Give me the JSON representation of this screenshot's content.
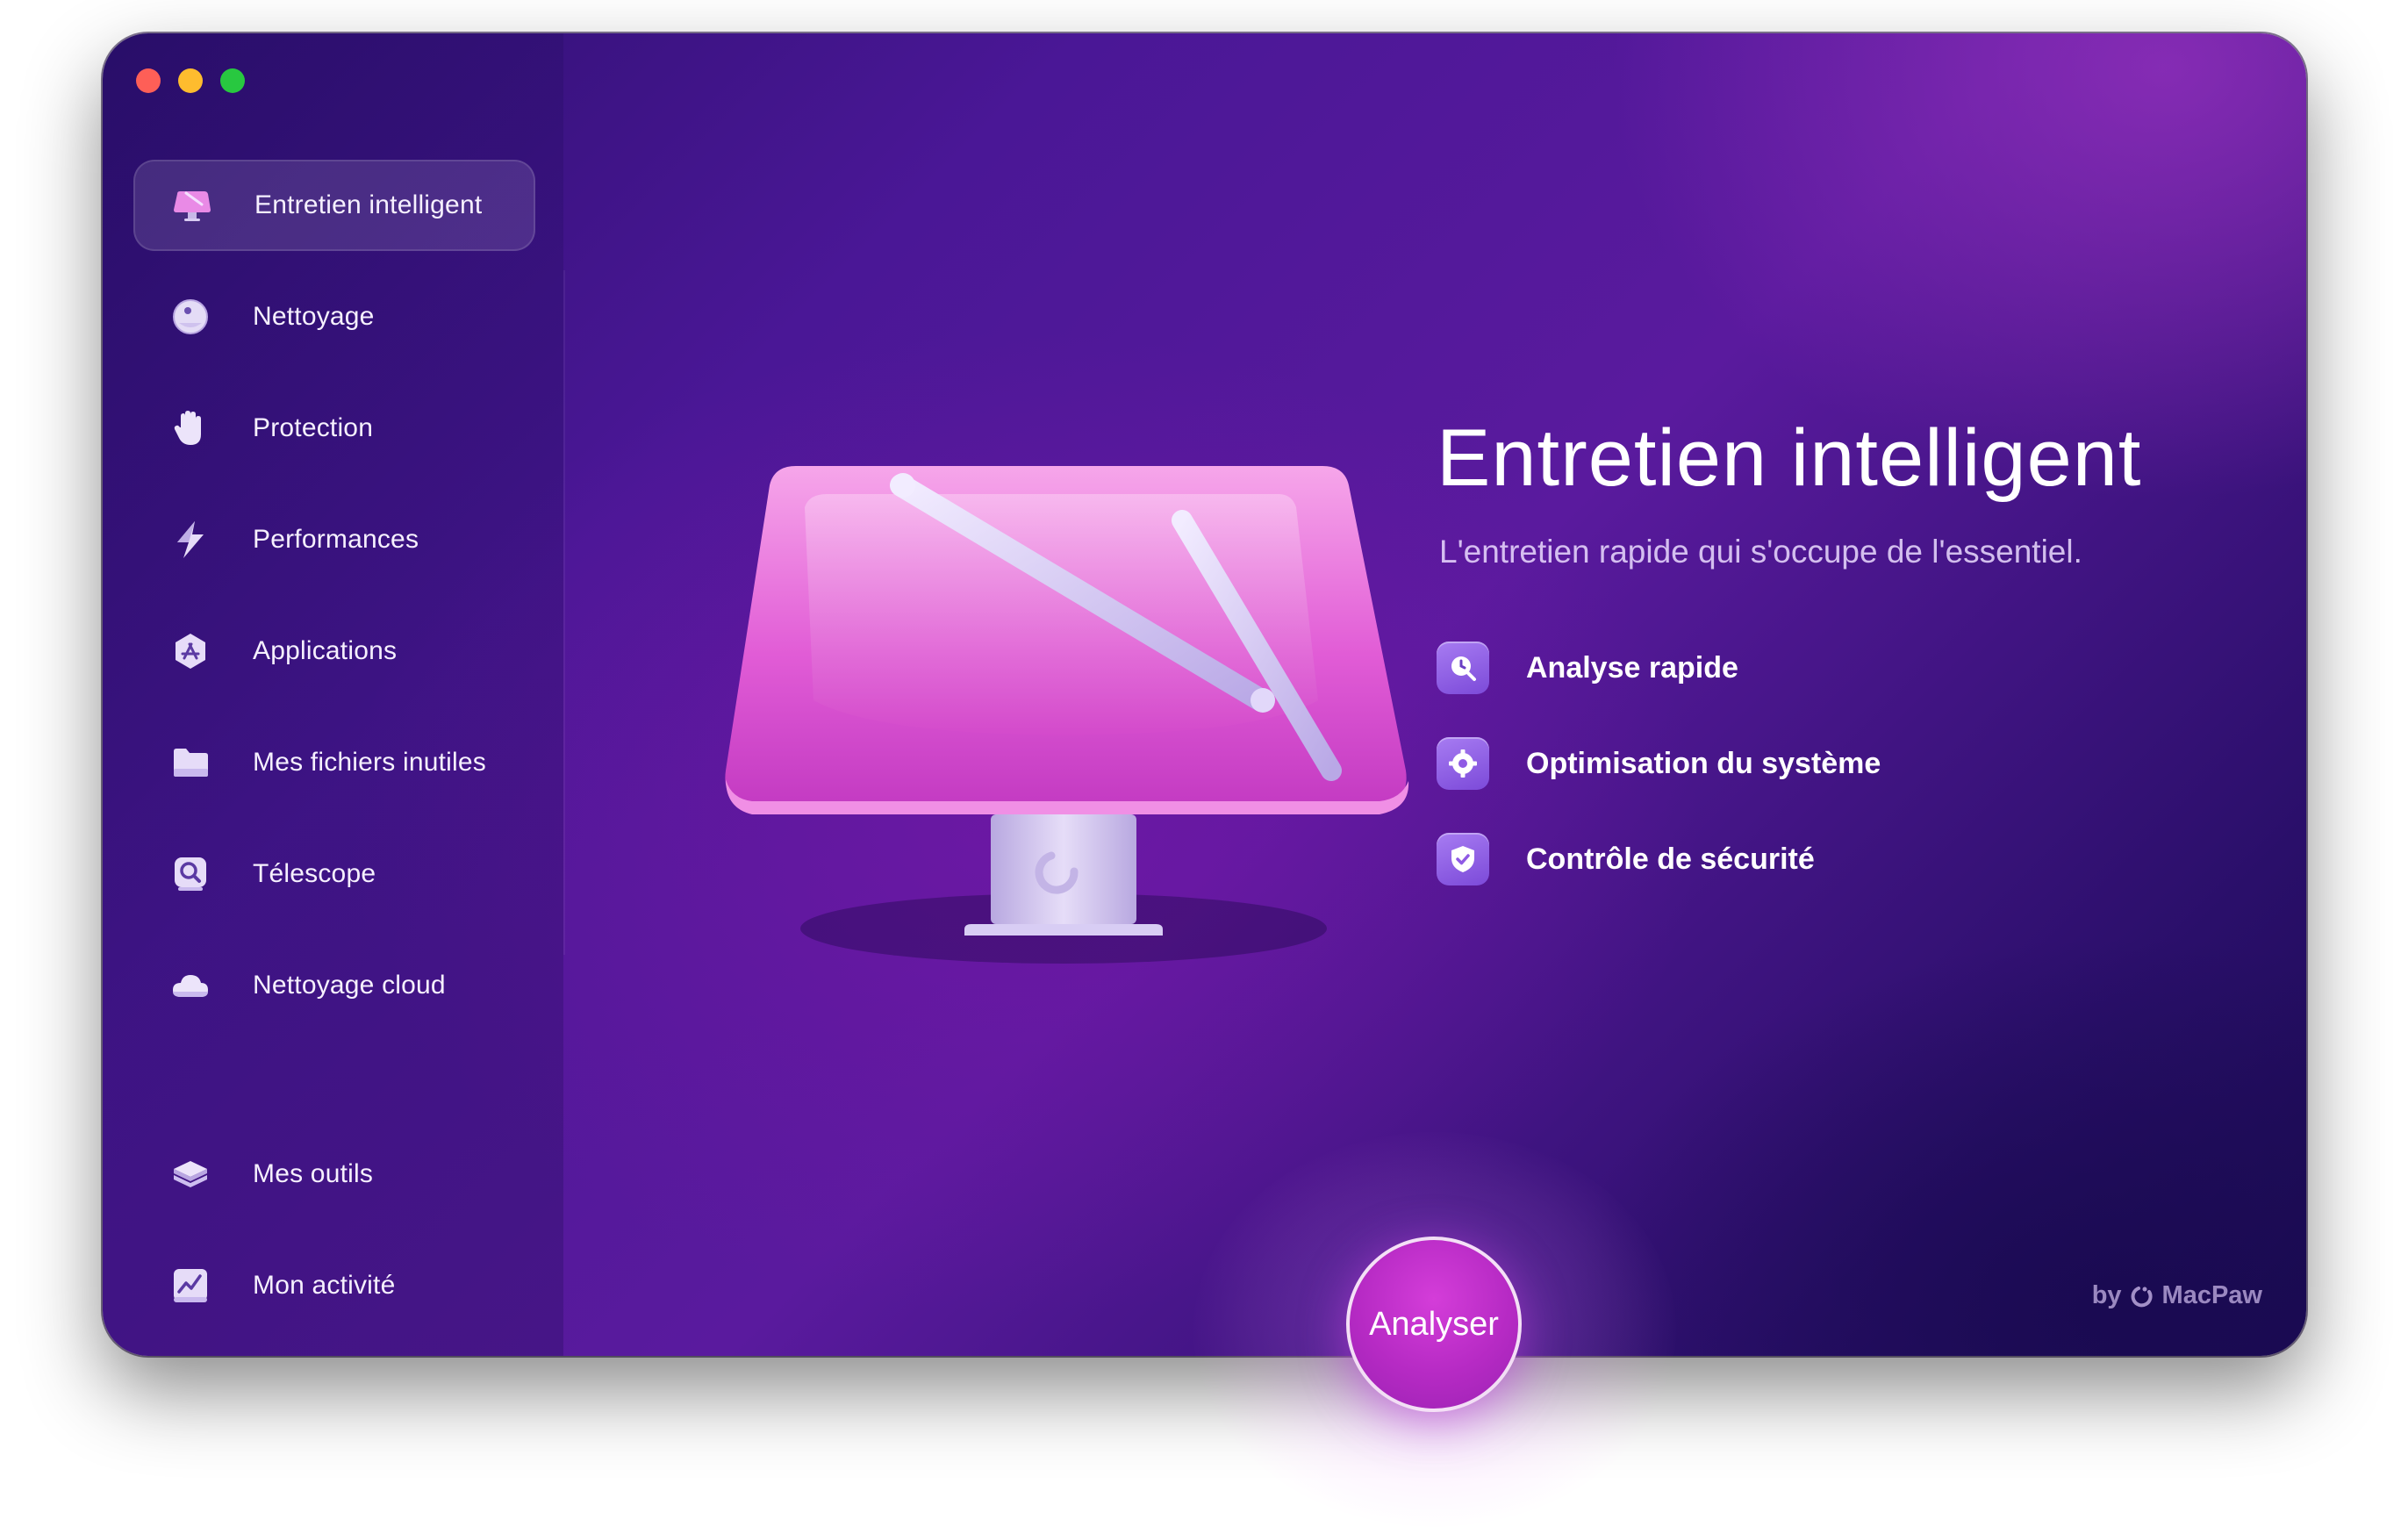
{
  "sidebar": {
    "items": [
      {
        "label": "Entretien intelligent",
        "icon": "smart-care-icon",
        "active": true
      },
      {
        "label": "Nettoyage",
        "icon": "cleanup-icon"
      },
      {
        "label": "Protection",
        "icon": "hand-icon"
      },
      {
        "label": "Performances",
        "icon": "lightning-icon"
      },
      {
        "label": "Applications",
        "icon": "app-store-icon"
      },
      {
        "label": "Mes fichiers inutiles",
        "icon": "folder-icon"
      },
      {
        "label": "Télescope",
        "icon": "magnifier-icon"
      },
      {
        "label": "Nettoyage cloud",
        "icon": "cloud-icon"
      }
    ],
    "bottom_items": [
      {
        "label": "Mes outils",
        "icon": "layers-icon"
      },
      {
        "label": "Mon activité",
        "icon": "activity-chart-icon"
      }
    ]
  },
  "hero": {
    "title": "Entretien intelligent",
    "subtitle": "L'entretien rapide qui s'occupe de l'essentiel.",
    "features": [
      {
        "label": "Analyse rapide",
        "icon": "clock-magnifier-icon"
      },
      {
        "label": "Optimisation du système",
        "icon": "gear-icon"
      },
      {
        "label": "Contrôle de sécurité",
        "icon": "shield-check-icon"
      }
    ]
  },
  "actions": {
    "scan_label": "Analyser"
  },
  "branding": {
    "prefix": "by",
    "name": "MacPaw"
  },
  "colors": {
    "accent": "#c233d0",
    "background": "#4a1796",
    "feature_icon": "#8f5ae4"
  }
}
